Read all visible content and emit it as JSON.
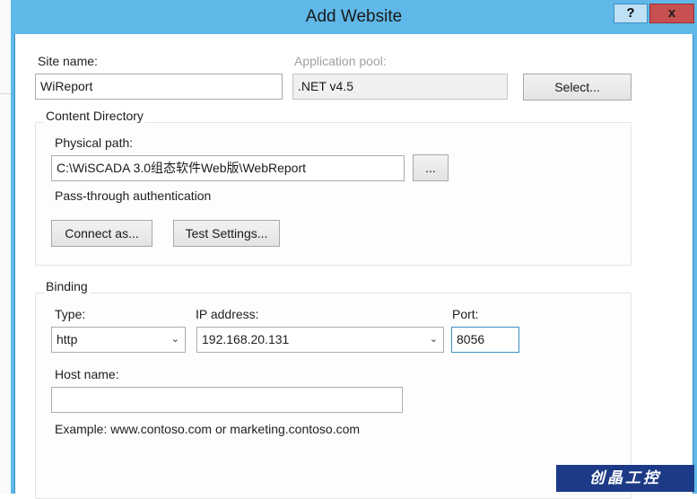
{
  "window": {
    "title": "Add Website",
    "help_label": "?",
    "close_label": "x"
  },
  "site": {
    "name_label": "Site name:",
    "name_value": "WiReport",
    "pool_label": "Application pool:",
    "pool_value": ".NET v4.5",
    "select_label": "Select..."
  },
  "content_directory": {
    "legend": "Content Directory",
    "path_label": "Physical path:",
    "path_value": "C:\\WiSCADA 3.0组态软件Web版\\WebReport",
    "browse_label": "...",
    "auth_label": "Pass-through authentication",
    "connect_label": "Connect as...",
    "test_label": "Test Settings..."
  },
  "binding": {
    "legend": "Binding",
    "type_label": "Type:",
    "type_value": "http",
    "ip_label": "IP address:",
    "ip_value": "192.168.20.131",
    "port_label": "Port:",
    "port_value": "8056",
    "host_label": "Host name:",
    "host_value": "",
    "example": "Example: www.contoso.com or marketing.contoso.com"
  },
  "watermark": {
    "text": "创晶工控"
  },
  "colors": {
    "title_bar": "#5fb8e8",
    "close_button": "#c75050",
    "watermark_bg": "#1d3a86"
  }
}
